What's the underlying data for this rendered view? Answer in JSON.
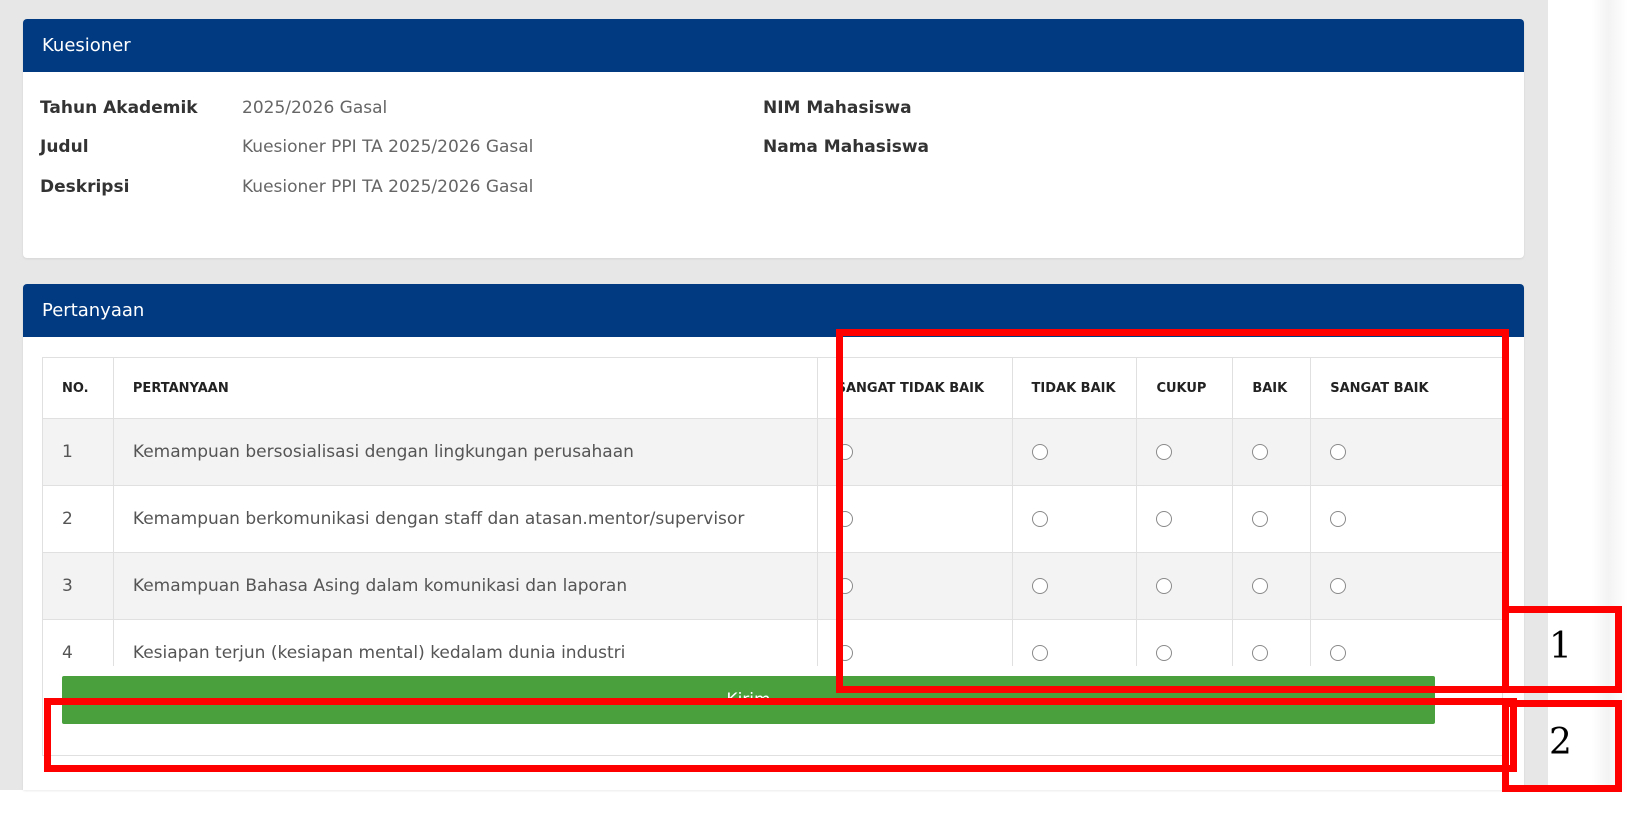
{
  "kuesioner": {
    "title": "Kuesioner",
    "fields": {
      "tahun_label": "Tahun Akademik",
      "tahun_value": "2025/2026 Gasal",
      "judul_label": "Judul",
      "judul_value": "Kuesioner PPI TA 2025/2026 Gasal",
      "deskripsi_label": "Deskripsi",
      "deskripsi_value": "Kuesioner PPI TA 2025/2026 Gasal",
      "nim_label": "NIM Mahasiswa",
      "nama_label": "Nama Mahasiswa"
    }
  },
  "pertanyaan": {
    "title": "Pertanyaan",
    "columns": {
      "no": "NO.",
      "pertanyaan": "PERTANYAAN",
      "c1": "SANGAT TIDAK BAIK",
      "c2": "TIDAK BAIK",
      "c3": "CUKUP",
      "c4": "BAIK",
      "c5": "SANGAT BAIK"
    },
    "rows": [
      {
        "no": "1",
        "text": "Kemampuan bersosialisasi dengan lingkungan perusahaan"
      },
      {
        "no": "2",
        "text": "Kemampuan berkomunikasi dengan staff dan atasan.mentor/supervisor"
      },
      {
        "no": "3",
        "text": "Kemampuan Bahasa Asing dalam komunikasi dan laporan"
      },
      {
        "no": "4",
        "text": "Kesiapan terjun (kesiapan mental) kedalam dunia industri"
      }
    ],
    "submit_label": "Kirim"
  },
  "annotations": {
    "one": "1",
    "two": "2"
  },
  "colors": {
    "header": "#013a81",
    "button": "#4aa03d",
    "annotation": "#ff0000"
  }
}
